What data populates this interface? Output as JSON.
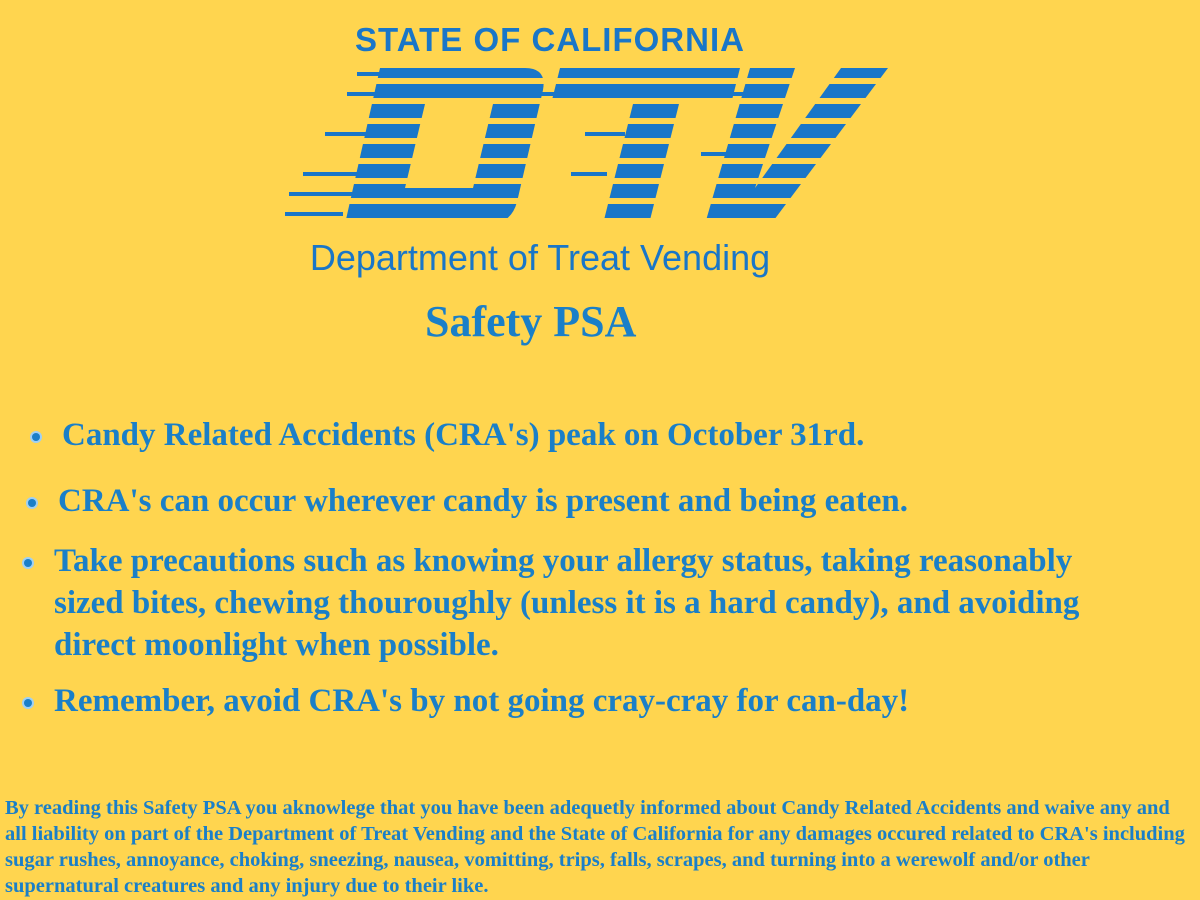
{
  "logo": {
    "top_text": "STATE OF CALIFORNIA",
    "mark_text": "DTV",
    "subtitle": "Department of Treat Vending"
  },
  "title": "Safety PSA",
  "bullets": [
    "Candy Related Accidents (CRA's) peak on October 31rd.",
    "CRA's can occur wherever candy is present and being eaten.",
    "Take precautions such as knowing your allergy status, taking reasonably sized bites, chewing thouroughly (unless it is a hard candy), and avoiding direct moonlight when possible.",
    "Remember, avoid CRA's by not going cray-cray for can-day!"
  ],
  "disclaimer": "By reading this Safety PSA you aknowlege that you have been adequetly informed about Candy Related Accidents and waive any and all liability on part of the Department of Treat Vending and the State of California for any damages occured related to CRA's including sugar rushes, annoyance, choking, sneezing, nausea, vomitting, trips, falls, scrapes, and turning into a werewolf and/or other supernatural creatures and any injury due to their like.",
  "colors": {
    "background": "#ffd54f",
    "text": "#1a7fc8",
    "logo": "#1976c8"
  }
}
